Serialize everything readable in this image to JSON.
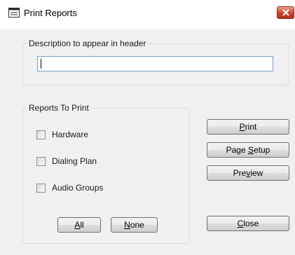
{
  "window": {
    "title": "Print Reports",
    "icon": "form-icon",
    "close_icon": "close-icon",
    "close_color": "#c8432b"
  },
  "header_group": {
    "legend": "Description to appear in header",
    "input": {
      "value": "",
      "placeholder": ""
    }
  },
  "reports_group": {
    "legend": "Reports To Print",
    "items": [
      {
        "label": "Hardware",
        "checked": false
      },
      {
        "label": "Dialing Plan",
        "checked": false
      },
      {
        "label": "Audio Groups",
        "checked": false
      }
    ]
  },
  "buttons": {
    "all": {
      "pre": "",
      "key": "A",
      "post": "ll"
    },
    "none": {
      "pre": "",
      "key": "N",
      "post": "one"
    },
    "print": {
      "pre": "",
      "key": "P",
      "post": "rint"
    },
    "page_setup": {
      "pre": "Page ",
      "key": "S",
      "post": "etup"
    },
    "preview": {
      "pre": "Pre",
      "key": "v",
      "post": "iew"
    },
    "close": {
      "pre": "",
      "key": "C",
      "post": "lose"
    }
  }
}
